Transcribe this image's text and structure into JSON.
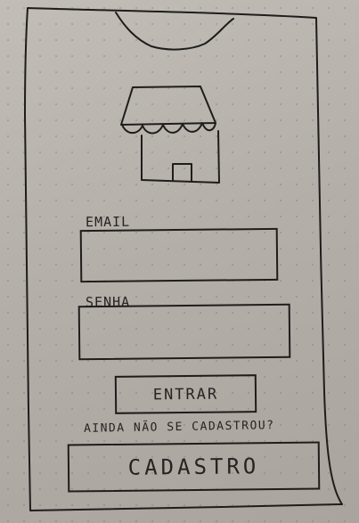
{
  "login": {
    "email_label": "EMAIL",
    "password_label": "SENHA",
    "email_value": "",
    "password_value": "",
    "enter_label": "ENTRAR",
    "signup_prompt": "AINDA NÃO SE CADASTROU?",
    "signup_label": "CADASTRO"
  },
  "icons": {
    "logo": "storefront-icon",
    "notch": "phone-notch"
  },
  "colors": {
    "paper": "#b4afa9",
    "ink": "#1f1d1c"
  }
}
